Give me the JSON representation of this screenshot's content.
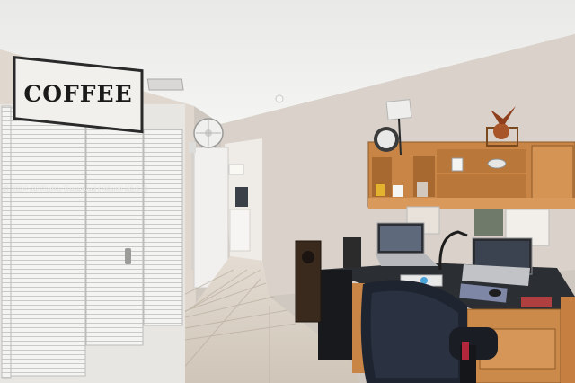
{
  "photo": {
    "sign_text": "COFFEE",
    "watermark": "© 2024 All Rights Reserved | Miami MLS ®",
    "colors": {
      "ceiling": "#eeeeec",
      "wall": "#dcd5cf",
      "closet_doors": "#f3f3f1",
      "floor_tile": "#d8cfc4",
      "desk_wood": "#cf8b48",
      "chair": "#1d2330"
    }
  }
}
